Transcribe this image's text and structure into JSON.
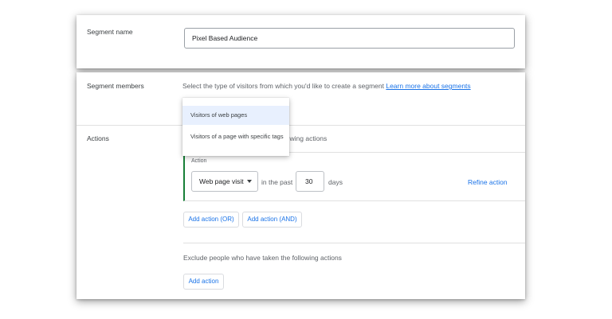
{
  "segment_name": {
    "label": "Segment name",
    "value": "Pixel Based Audience"
  },
  "segment_members": {
    "label": "Segment members",
    "description": "Select the type of visitors from which you'd like to create a segment",
    "learn_more_link": "Learn more about segments",
    "dropdown": {
      "options": [
        "Visitors of web pages",
        "Visitors of a page with specific tags"
      ],
      "highlighted": "Visitors of web pages"
    }
  },
  "actions": {
    "label": "Actions",
    "partial_text": "llowing actions",
    "action_label": "Action",
    "action_type": "Web page visit",
    "in_the_past": "in the past",
    "days_value": "30",
    "days_label": "days",
    "refine_action": "Refine action",
    "add_action_or": "Add action (OR)",
    "add_action_and": "Add action (AND)",
    "exclude_text": "Exclude people who have taken the following actions",
    "add_action": "Add action"
  },
  "colors": {
    "link": "#1a73e8",
    "action_accent": "#188038",
    "highlight": "#e8f0fe"
  }
}
